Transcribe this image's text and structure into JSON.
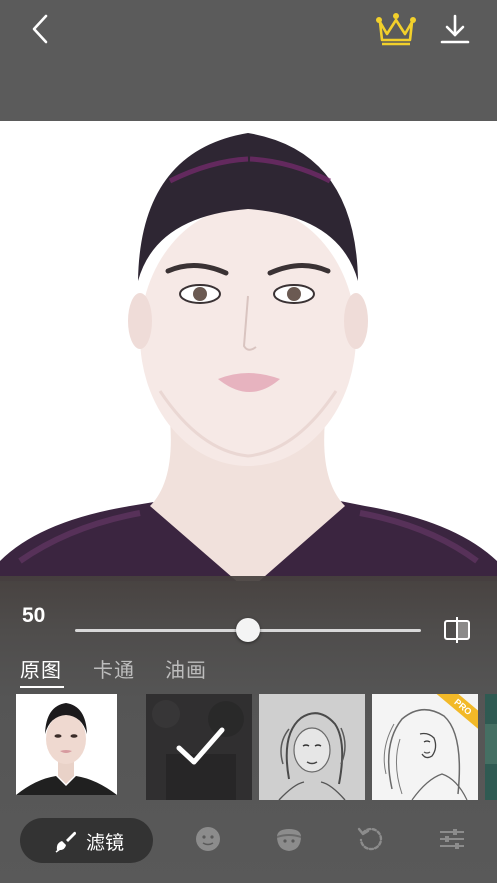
{
  "header": {
    "back_icon": "chevron-left-icon",
    "crown_icon": "crown-icon",
    "download_icon": "download-icon",
    "crown_color": "#f2d02b"
  },
  "slider": {
    "value_label": "50",
    "value": 50,
    "max": 100,
    "compare_icon": "compare-split-icon"
  },
  "tabs": [
    {
      "label": "原图",
      "active": true
    },
    {
      "label": "卡通",
      "active": false
    },
    {
      "label": "油画",
      "active": false
    }
  ],
  "filters": [
    {
      "name": "original",
      "selected": false,
      "pro": false
    },
    {
      "name": "dark-selected",
      "selected": true,
      "pro": false
    },
    {
      "name": "sketch-1",
      "selected": false,
      "pro": false
    },
    {
      "name": "sketch-2",
      "selected": false,
      "pro": true,
      "badge": "PRO"
    },
    {
      "name": "partial",
      "selected": false,
      "pro": false
    }
  ],
  "toolbar": {
    "filter_label": "滤镜",
    "filter_icon": "brush-icon",
    "tools": [
      "face-icon",
      "face-mask-icon",
      "reset-icon",
      "sliders-icon"
    ]
  }
}
